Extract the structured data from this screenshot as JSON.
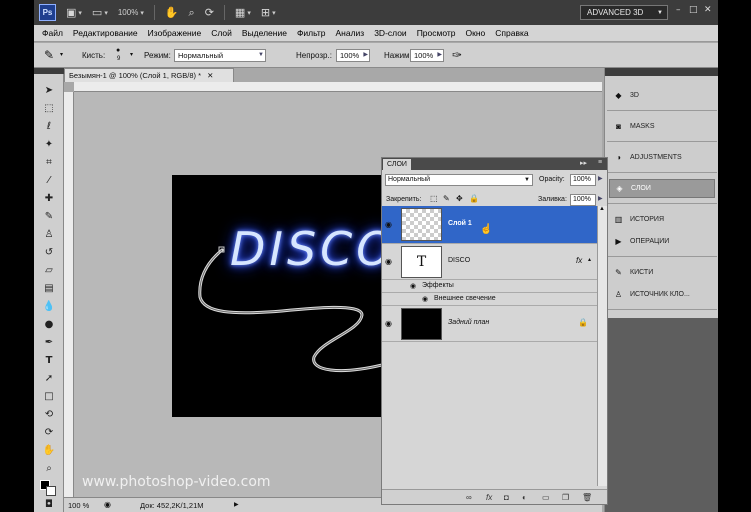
{
  "appbar": {
    "logo": "Ps",
    "zoom": "100%",
    "workspace": "ADVANCED 3D",
    "icons": [
      "bridge-icon",
      "screen-mode-icon",
      "hand-icon",
      "zoom-icon",
      "rotate-view-icon",
      "arrange-icon",
      "extras-icon"
    ],
    "window_minimize": "–",
    "window_restore": "□",
    "window_close": "✕"
  },
  "menu": [
    "Файл",
    "Редактирование",
    "Изображение",
    "Слой",
    "Выделение",
    "Фильтр",
    "Анализ",
    "3D-слои",
    "Просмотр",
    "Окно",
    "Справка"
  ],
  "options": {
    "brush_label": "Кисть:",
    "brush_size": "9",
    "mode_label": "Режим:",
    "mode_value": "Нормальный",
    "opacity_label": "Непрозр.:",
    "opacity_value": "100%",
    "pressure_label": "Нажим:",
    "pressure_value": "100%"
  },
  "document": {
    "tab_title": "Безымян-1 @ 100% (Слой 1, RGB/8) *",
    "canvas_text": "DISCO",
    "zoom": "100 %",
    "doc_info": "Док: 452,2K/1,21M"
  },
  "watermark": "www.photoshop-video.com",
  "dock": [
    {
      "icon": "3d-icon",
      "label": "3D"
    },
    {
      "icon": "masks-icon",
      "label": "MASKS"
    },
    {
      "icon": "adjustments-icon",
      "label": "ADJUSTMENTS"
    },
    {
      "icon": "layers-icon",
      "label": "СЛОИ",
      "active": true
    },
    {
      "icon": "history-icon",
      "label": "ИСТОРИЯ"
    },
    {
      "icon": "actions-icon",
      "label": "ОПЕРАЦИИ"
    },
    {
      "icon": "brushes-icon",
      "label": "КИСТИ"
    },
    {
      "icon": "clone-source-icon",
      "label": "ИСТОЧНИК КЛО..."
    }
  ],
  "layers_panel": {
    "tab": "СЛОИ",
    "blend_mode": "Нормальный",
    "opacity_label": "Opacity:",
    "opacity_value": "100%",
    "lock_label": "Закрепить:",
    "fill_label": "Заливка:",
    "fill_value": "100%",
    "layers": [
      {
        "name": "Слой 1",
        "selected": true,
        "thumb": "transparent"
      },
      {
        "name": "DISCO",
        "selected": false,
        "thumb": "text",
        "fx": "fx",
        "glyph": "T"
      },
      {
        "name": "Задний план",
        "selected": false,
        "thumb": "black",
        "locked": true
      }
    ],
    "effects_label": "Эффекты",
    "outer_glow_label": "Внешнее свечение",
    "colors": {
      "selection": "#3066c8",
      "glow": "#1e3cff"
    }
  }
}
